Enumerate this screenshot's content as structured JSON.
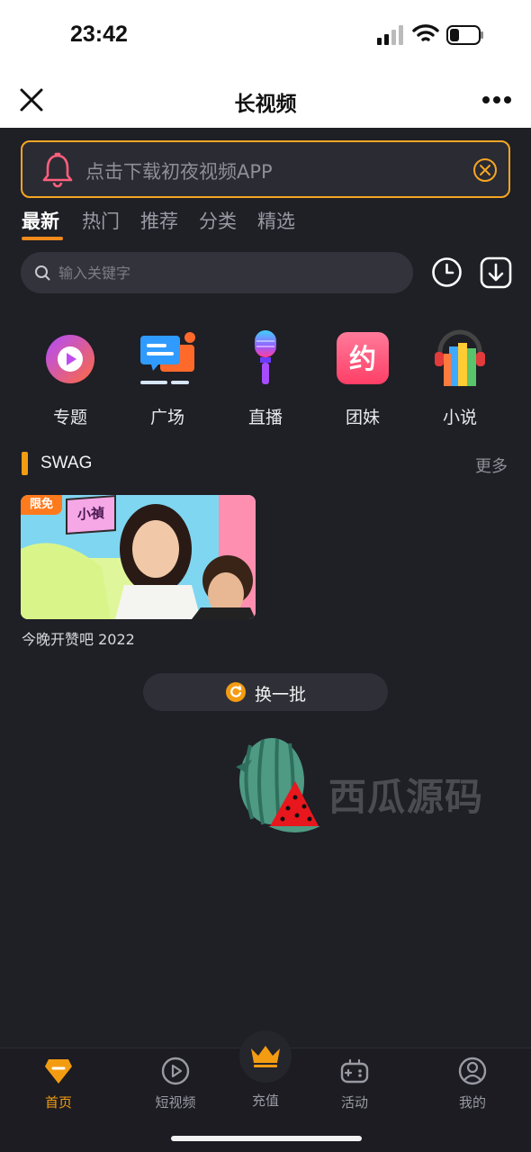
{
  "status_bar": {
    "time": "23:42"
  },
  "nav": {
    "title": "长视频"
  },
  "banner": {
    "text": "点击下载初夜视频APP"
  },
  "tabs": [
    {
      "label": "最新",
      "active": true
    },
    {
      "label": "热门"
    },
    {
      "label": "推荐"
    },
    {
      "label": "分类"
    },
    {
      "label": "精选"
    }
  ],
  "search": {
    "placeholder": "输入关键字"
  },
  "categories": [
    {
      "label": "专题",
      "icon": "topic-icon"
    },
    {
      "label": "广场",
      "icon": "square-icon"
    },
    {
      "label": "直播",
      "icon": "live-icon"
    },
    {
      "label": "团妹",
      "icon": "date-icon"
    },
    {
      "label": "小说",
      "icon": "novel-icon"
    }
  ],
  "section": {
    "title": "SWAG",
    "more": "更多"
  },
  "videos": [
    {
      "title": "今晚开赞吧 2022",
      "badge": "限免",
      "tag": "小禎"
    }
  ],
  "refresh": {
    "label": "换一批"
  },
  "watermark": {
    "text": "西瓜源码"
  },
  "bottom_nav": [
    {
      "label": "首页",
      "active": true
    },
    {
      "label": "短视频"
    },
    {
      "label": "充值"
    },
    {
      "label": "活动"
    },
    {
      "label": "我的"
    }
  ],
  "colors": {
    "accent": "#f39c12",
    "background": "#1f1f26",
    "banner_border": "#f5a623"
  }
}
